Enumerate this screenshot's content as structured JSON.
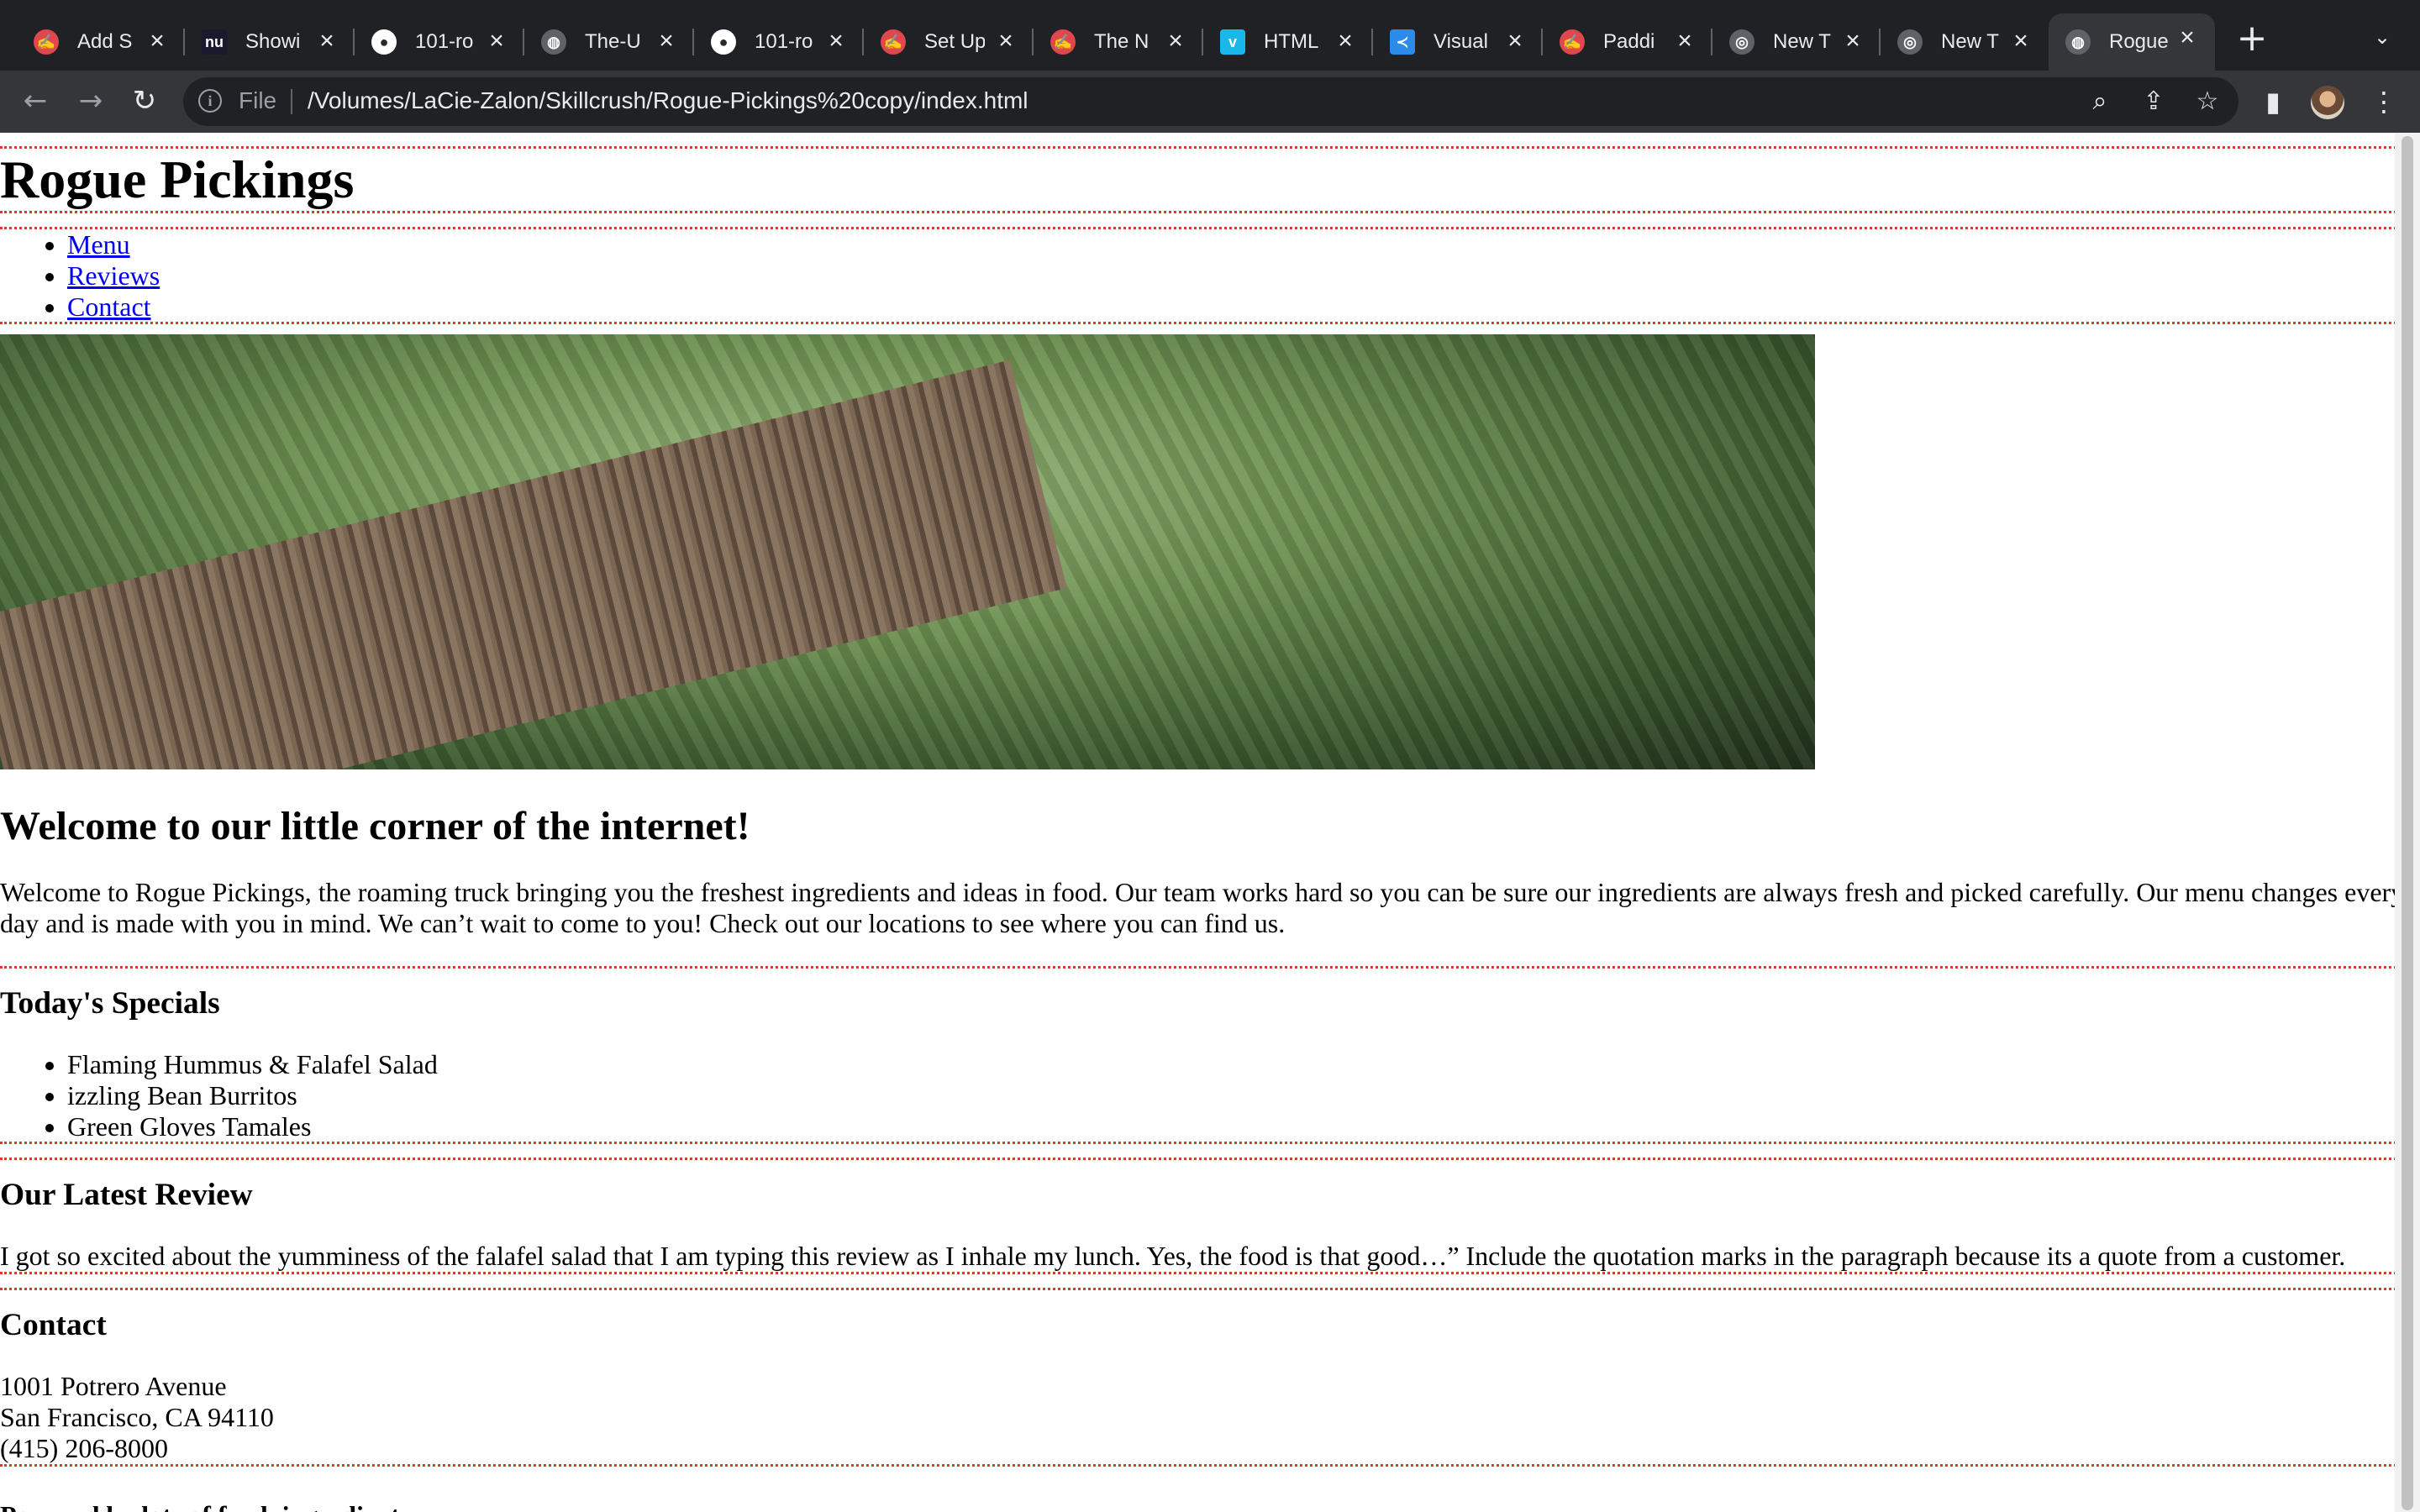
{
  "browser": {
    "tabs": [
      {
        "label": "Add S",
        "icon": "skillcrush-icon",
        "color": "#e0474c"
      },
      {
        "label": "Showi",
        "icon": "nu-icon",
        "color": "#1a1a2e"
      },
      {
        "label": "101-ro",
        "icon": "github-icon",
        "color": "#24292e"
      },
      {
        "label": "The-U",
        "icon": "globe-icon",
        "color": "#5f6368"
      },
      {
        "label": "101-ro",
        "icon": "github-icon",
        "color": "#24292e"
      },
      {
        "label": "Set Up",
        "icon": "skillcrush-icon",
        "color": "#e0474c"
      },
      {
        "label": "The N",
        "icon": "skillcrush-icon",
        "color": "#e0474c"
      },
      {
        "label": "HTML",
        "icon": "vimeo-icon",
        "color": "#1ab7ea"
      },
      {
        "label": "Visual",
        "icon": "vscode-icon",
        "color": "#2c8ae8"
      },
      {
        "label": "Paddi",
        "icon": "skillcrush-icon",
        "color": "#e0474c"
      },
      {
        "label": "New T",
        "icon": "chrome-icon",
        "color": "#5f6368"
      },
      {
        "label": "New T",
        "icon": "chrome-icon",
        "color": "#5f6368"
      },
      {
        "label": "Rogue",
        "icon": "globe-icon",
        "color": "#5f6368",
        "active": true
      }
    ],
    "address": {
      "scheme_label": "File",
      "url": "/Volumes/LaCie-Zalon/Skillcrush/Rogue-Pickings%20copy/index.html"
    }
  },
  "page": {
    "title": "Rogue Pickings",
    "nav": [
      "Menu",
      "Reviews",
      "Contact"
    ],
    "welcome": {
      "heading": "Welcome to our little corner of the internet!",
      "body": "Welcome to Rogue Pickings, the roaming truck bringing you the freshest ingredients and ideas in food. Our team works hard so you can be sure our ingredients are always fresh and picked carefully. Our menu changes every day and is made with you in mind. We can’t wait to come to you! Check out our locations to see where you can find us."
    },
    "specials": {
      "heading": "Today's Specials",
      "items": [
        "Flaming Hummus & Falafel Salad",
        "izzling Bean Burritos",
        "Green Gloves Tamales"
      ]
    },
    "review": {
      "heading": "Our Latest Review",
      "body": "I got so excited about the yumminess of the falafel salad that I am typing this review as I inhale my lunch. Yes, the food is that good…” Include the quotation marks in the paragraph because its a quote from a customer."
    },
    "contact": {
      "heading": "Contact",
      "address_line1": "1001 Potrero Avenue",
      "address_line2": "San Francisco, CA 94110",
      "phone": "(415) 206-8000"
    },
    "footer": "Powered by lots of fresh ingredients."
  },
  "colors": {
    "section_border": "#e8332a",
    "link": "#0000ee",
    "chrome_bg": "#202124",
    "toolbar_bg": "#35363a"
  }
}
